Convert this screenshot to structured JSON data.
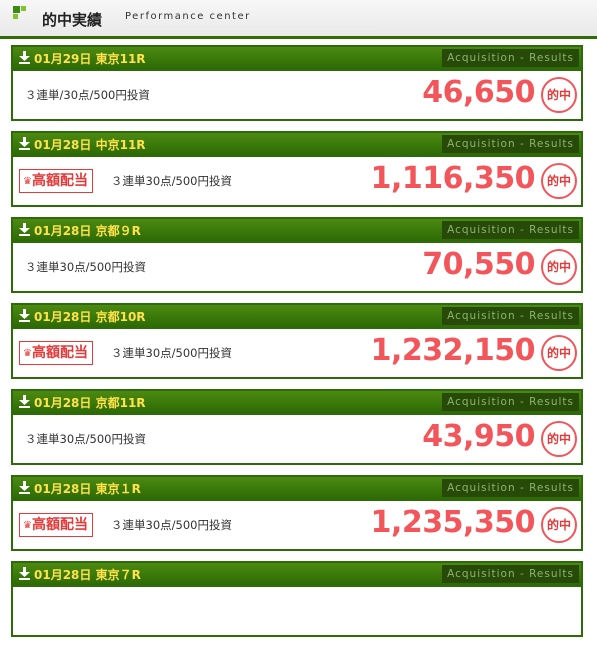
{
  "header": {
    "title": "的中実績",
    "subtitle": "Performance center",
    "logo_icon": "green-squares-logo",
    "colors": {
      "accent": "#2f6b06"
    }
  },
  "results": [
    {
      "date": "01月29日",
      "race": "東京11R",
      "tag": "Acquisition - Results",
      "high_payout": false,
      "high_payout_label": "",
      "bet": "３連単/30点/500円投資",
      "amount": "46,650",
      "hit_label": "的中"
    },
    {
      "date": "01月28日",
      "race": "中京11R",
      "tag": "Acquisition - Results",
      "high_payout": true,
      "high_payout_label": "高額配当",
      "bet": "３連単30点/500円投資",
      "amount": "1,116,350",
      "hit_label": "的中"
    },
    {
      "date": "01月28日",
      "race": "京都９R",
      "tag": "Acquisition - Results",
      "high_payout": false,
      "high_payout_label": "",
      "bet": "３連単30点/500円投資",
      "amount": "70,550",
      "hit_label": "的中"
    },
    {
      "date": "01月28日",
      "race": "京都10R",
      "tag": "Acquisition - Results",
      "high_payout": true,
      "high_payout_label": "高額配当",
      "bet": "３連単30点/500円投資",
      "amount": "1,232,150",
      "hit_label": "的中"
    },
    {
      "date": "01月28日",
      "race": "京都11R",
      "tag": "Acquisition - Results",
      "high_payout": false,
      "high_payout_label": "",
      "bet": "３連単30点/500円投資",
      "amount": "43,950",
      "hit_label": "的中"
    },
    {
      "date": "01月28日",
      "race": "東京１R",
      "tag": "Acquisition - Results",
      "high_payout": true,
      "high_payout_label": "高額配当",
      "bet": "３連単30点/500円投資",
      "amount": "1,235,350",
      "hit_label": "的中"
    },
    {
      "date": "01月28日",
      "race": "東京７R",
      "tag": "Acquisition - Results",
      "high_payout": false,
      "high_payout_label": "",
      "bet": "",
      "amount": "",
      "hit_label": ""
    }
  ]
}
